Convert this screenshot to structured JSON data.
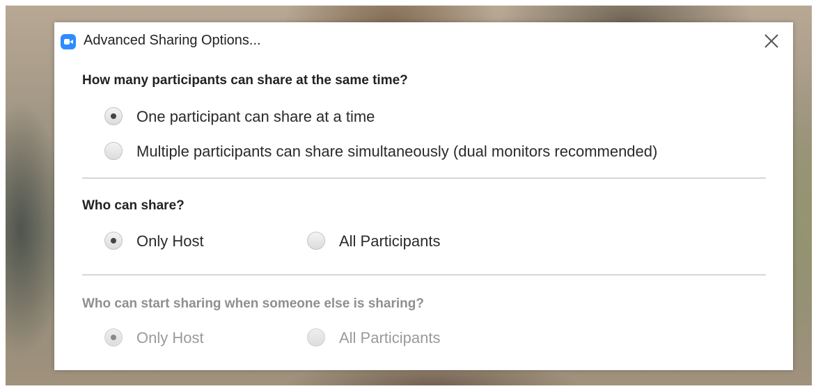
{
  "dialog": {
    "title": "Advanced Sharing Options...",
    "app_icon": "zoom-camera-icon",
    "close_icon": "close-icon"
  },
  "sections": [
    {
      "title": "How many participants can share at the same time?",
      "enabled": true,
      "options": [
        {
          "label": "One participant can share at a time",
          "selected": true
        },
        {
          "label": "Multiple participants can share simultaneously (dual monitors recommended)",
          "selected": false
        }
      ]
    },
    {
      "title": "Who can share?",
      "enabled": true,
      "options": [
        {
          "label": "Only Host",
          "selected": true
        },
        {
          "label": "All Participants",
          "selected": false
        }
      ]
    },
    {
      "title": "Who can start sharing when someone else is sharing?",
      "enabled": false,
      "options": [
        {
          "label": "Only Host",
          "selected": true
        },
        {
          "label": "All Participants",
          "selected": false
        }
      ]
    }
  ],
  "colors": {
    "accent": "#2d8cff",
    "text": "#222222",
    "disabled_text": "#9a9a9a",
    "divider": "#d6d6d6"
  }
}
